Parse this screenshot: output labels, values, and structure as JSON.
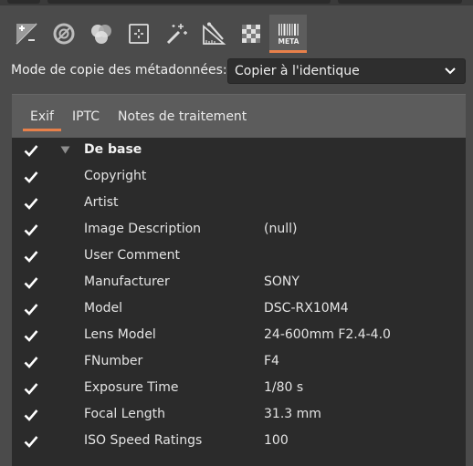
{
  "toolbar": {
    "tools": [
      {
        "icon": "exposure-plus-minus-icon",
        "active": false
      },
      {
        "icon": "lens-correction-icon",
        "active": false
      },
      {
        "icon": "color-circles-icon",
        "active": false
      },
      {
        "icon": "crop-frame-icon",
        "active": false
      },
      {
        "icon": "magic-wand-icon",
        "active": false
      },
      {
        "icon": "geometry-tools-icon",
        "active": false
      },
      {
        "icon": "checkerboard-icon",
        "active": false
      },
      {
        "icon": "metadata-barcode-icon",
        "label": "META",
        "active": true
      }
    ],
    "accent": "#e8804a"
  },
  "copy_mode": {
    "label": "Mode de copie des métadonnées:",
    "value": "Copier à l'identique"
  },
  "tabs": [
    {
      "label": "Exif",
      "active": true
    },
    {
      "label": "IPTC",
      "active": false
    },
    {
      "label": "Notes de traitement",
      "active": false
    }
  ],
  "rows": [
    {
      "name": "De base",
      "value": "",
      "checked": true,
      "group": true
    },
    {
      "name": "Copyright",
      "value": "",
      "checked": true
    },
    {
      "name": "Artist",
      "value": "",
      "checked": true
    },
    {
      "name": "Image Description",
      "value": "(null)",
      "checked": true
    },
    {
      "name": "User Comment",
      "value": "",
      "checked": true
    },
    {
      "name": "Manufacturer",
      "value": "SONY",
      "checked": true
    },
    {
      "name": "Model",
      "value": "DSC-RX10M4",
      "checked": true
    },
    {
      "name": "Lens Model",
      "value": "24-600mm F2.4-4.0",
      "checked": true
    },
    {
      "name": "FNumber",
      "value": "F4",
      "checked": true
    },
    {
      "name": "Exposure Time",
      "value": "1/80 s",
      "checked": true
    },
    {
      "name": "Focal Length",
      "value": "31.3 mm",
      "checked": true
    },
    {
      "name": "ISO Speed Ratings",
      "value": "100",
      "checked": true
    }
  ]
}
